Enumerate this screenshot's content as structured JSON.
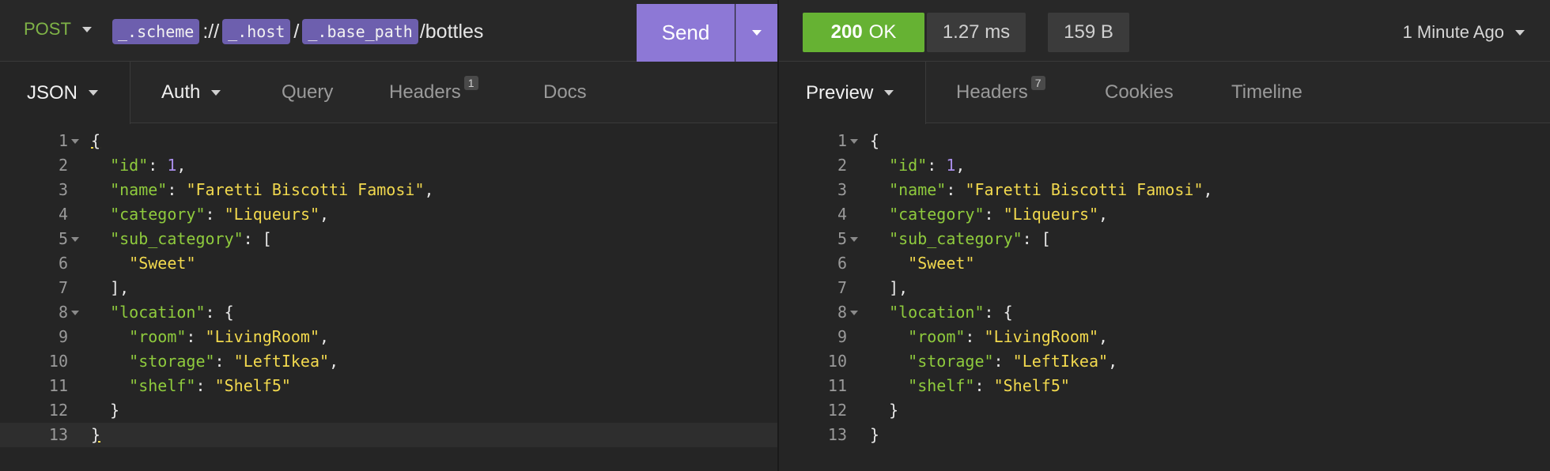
{
  "request": {
    "method": "POST",
    "url_vars": [
      "_.scheme",
      "_.host",
      "_.base_path"
    ],
    "url_seps": [
      "://",
      "/"
    ],
    "url_path": "/bottles",
    "send_label": "Send",
    "tabs": [
      {
        "label": "JSON",
        "active": true
      },
      {
        "label": "Auth"
      },
      {
        "label": "Query"
      },
      {
        "label": "Headers",
        "count": "1"
      },
      {
        "label": "Docs"
      }
    ]
  },
  "response": {
    "status_code": "200",
    "status_text": "OK",
    "time": "1.27 ms",
    "size": "159 B",
    "ago": "1 Minute Ago",
    "tabs": [
      {
        "label": "Preview",
        "active": true
      },
      {
        "label": "Headers",
        "count": "7"
      },
      {
        "label": "Cookies"
      },
      {
        "label": "Timeline"
      }
    ]
  },
  "body": {
    "id": "1",
    "name": "Faretti Biscotti Famosi",
    "category": "Liqueurs",
    "sub_category": [
      "Sweet"
    ],
    "location": {
      "room": "LivingRoom",
      "storage": "LeftIkea",
      "shelf": "Shelf5"
    }
  },
  "line_numbers": [
    "1",
    "2",
    "3",
    "4",
    "5",
    "6",
    "7",
    "8",
    "9",
    "10",
    "11",
    "12",
    "13"
  ],
  "colors": {
    "accent": "#8d78d6",
    "status_ok": "#66b233",
    "key": "#8fcb3d",
    "string": "#f2d94e",
    "number": "#a98eea"
  }
}
